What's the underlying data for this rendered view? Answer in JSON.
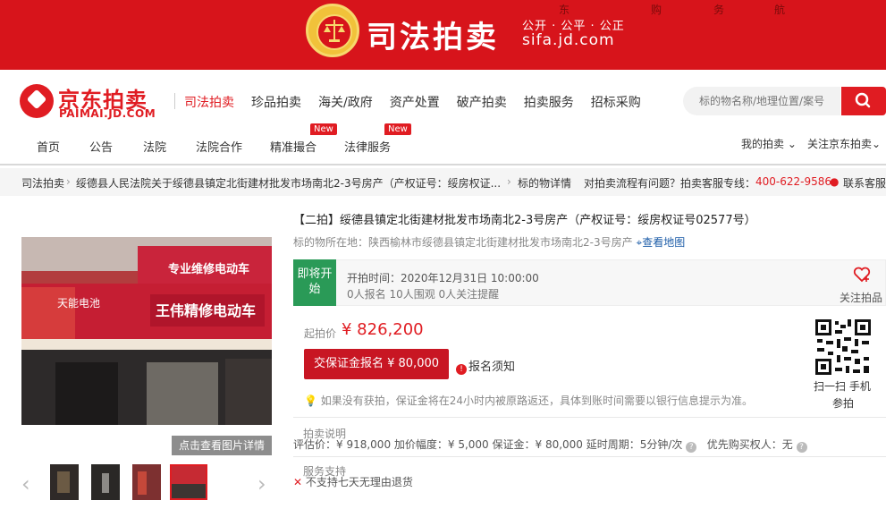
{
  "banner": {
    "title": "司法拍卖",
    "slogan": "公开 · 公平 · 公正",
    "domain": "sifa.jd.com",
    "toplinks": [
      "东",
      "购",
      "务",
      "航"
    ]
  },
  "logo": {
    "name": "京东拍卖",
    "sub": "PAIMAI.JD.COM"
  },
  "mainnav": [
    "司法拍卖",
    "珍品拍卖",
    "海关/政府",
    "资产处置",
    "破产拍卖",
    "拍卖服务",
    "招标采购"
  ],
  "search": {
    "placeholder": "标的物名称/地理位置/案号"
  },
  "subnav": [
    "首页",
    "公告",
    "法院",
    "法院合作",
    "精准撮合",
    "法律服务"
  ],
  "badges": [
    "New",
    "New"
  ],
  "usernav": {
    "my_auction": "我的拍卖",
    "follow": "关注京东拍卖"
  },
  "breadcrumb": {
    "root": "司法拍卖",
    "item": "绥德县人民法院关于绥德县镇定北街建材批发市场南北2-3号房产（产权证号：绥房权证...",
    "detail": "标的物详情",
    "help": "对拍卖流程有问题？拍卖客服专线：",
    "phone": "400-622-9586",
    "contact": "联系客服"
  },
  "gallery": {
    "view_button": "点击查看图片详情",
    "shop_signs": [
      "天能电池",
      "王伟精修电动车",
      "专业维修电动车"
    ]
  },
  "product": {
    "title": "【二拍】绥德县镇定北街建材批发市场南北2-3号房产（产权证号：绥房权证号02577号）",
    "location_label": "标的物所在地：",
    "location": "陕西榆林市绥德县镇定北街建材批发市场南北2-3号房产",
    "map_link": "查看地图",
    "status": "即将开始",
    "start_time": "开拍时间：2020年12月31日 10:00:00",
    "counts": "0人报名   10人围观   0人关注提醒",
    "follow": "关注拍品",
    "price_label": "起拍价",
    "price": "¥ 826,200",
    "deposit_button": "交保证金报名 ¥ 80,000",
    "notice": "报名须知",
    "tip": "如果没有获拍，保证金将在24小时内被原路返还，具体到账时间需要以银行信息提示为准。",
    "qr_label": "扫一扫 手机",
    "qr_label2": "参拍"
  },
  "terms": {
    "section": "拍卖说明",
    "text": "评估价：¥ 918,000    加价幅度：¥ 5,000    保证金：¥ 80,000    延时周期：5分钟/次",
    "priority": "优先购买权人：无"
  },
  "service": {
    "section": "服务支持",
    "text": "不支持七天无理由退货"
  }
}
